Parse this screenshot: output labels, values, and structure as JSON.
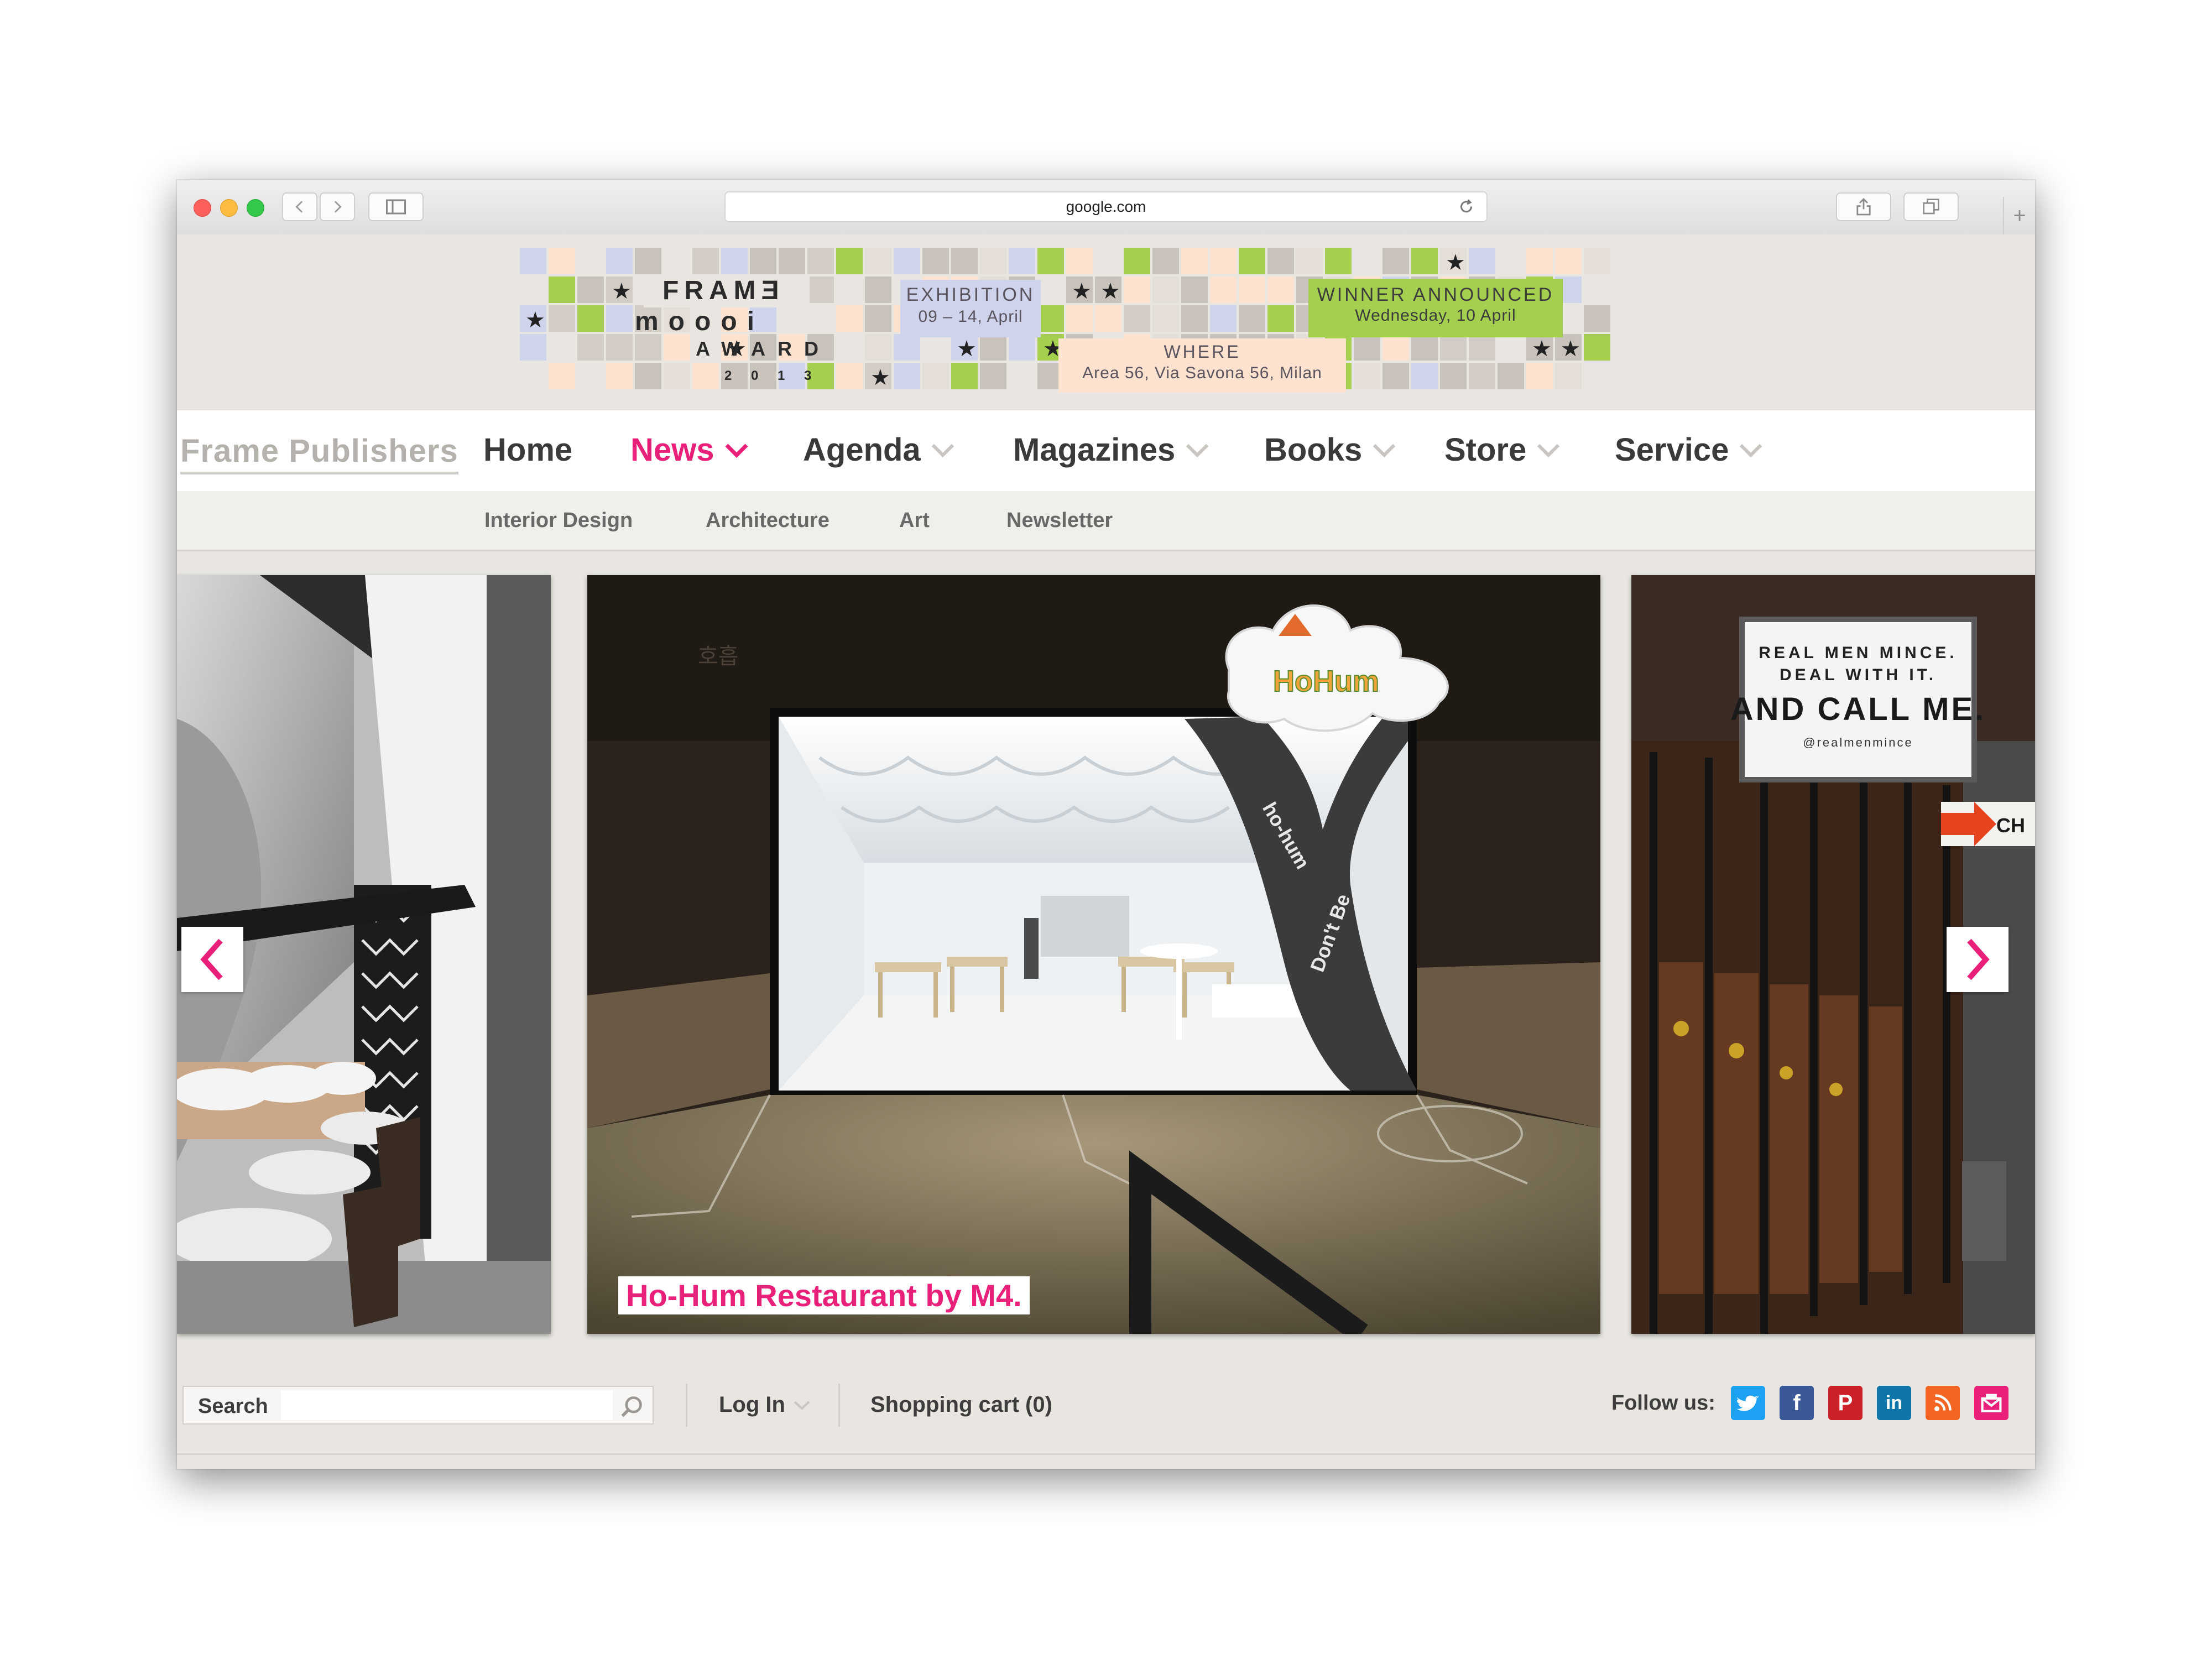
{
  "browser": {
    "url": "google.com"
  },
  "banner": {
    "frame_word": "FRAMƎ",
    "moooi_word": "moooi",
    "award_word": "AWARD",
    "year": "2 0 1 3",
    "exhibition_title": "EXHIBITION",
    "exhibition_dates": "09 – 14, April",
    "winner_title": "WINNER ANNOUNCED",
    "winner_date": "Wednesday, 10 April",
    "where_title": "WHERE",
    "where_address": "Area 56, Via Savona 56, Milan"
  },
  "nav": {
    "brand": "Frame Publishers",
    "items": [
      {
        "label": "Home",
        "dropdown": false,
        "active": false
      },
      {
        "label": "News",
        "dropdown": true,
        "active": true
      },
      {
        "label": "Agenda",
        "dropdown": true,
        "active": false
      },
      {
        "label": "Magazines",
        "dropdown": true,
        "active": false
      },
      {
        "label": "Books",
        "dropdown": true,
        "active": false
      },
      {
        "label": "Store",
        "dropdown": true,
        "active": false
      },
      {
        "label": "Service",
        "dropdown": true,
        "active": false
      }
    ]
  },
  "subnav": {
    "items": [
      "Interior Design",
      "Architecture",
      "Art",
      "Newsletter"
    ]
  },
  "slider": {
    "caption": "Ho-Hum Restaurant by M4.",
    "center_logo": "HoHum",
    "right_sign_line1": "REAL MEN MINCE.",
    "right_sign_line2": "DEAL WITH IT.",
    "right_sign_line3": "AND CALL ME.",
    "right_sign_handle": "@realmenmince",
    "right_partial_sign": "CH"
  },
  "footer": {
    "search_label": "Search",
    "search_placeholder": "",
    "login_label": "Log In",
    "cart_label": "Shopping cart (0)",
    "follow_label": "Follow us:",
    "social": [
      "twitter",
      "facebook",
      "pinterest",
      "linkedin",
      "rss",
      "email"
    ]
  },
  "colors": {
    "accent": "#e8207a",
    "page_bg": "#e9e6e1"
  }
}
